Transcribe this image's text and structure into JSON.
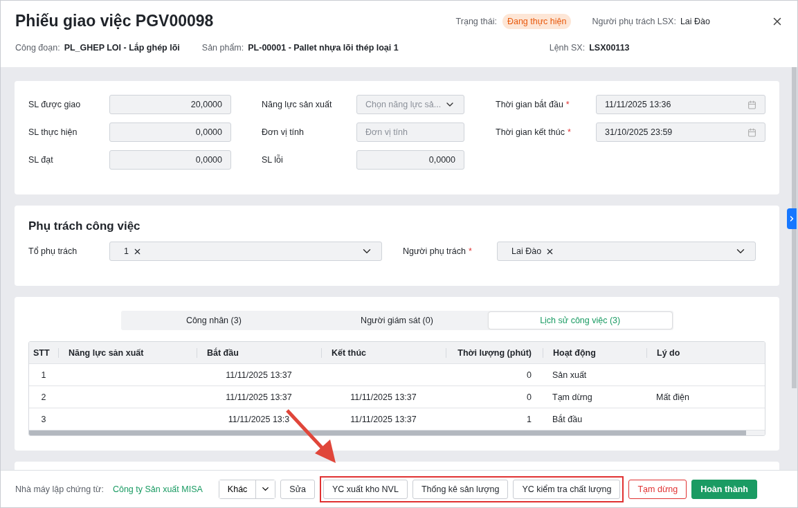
{
  "header": {
    "title": "Phiếu giao việc PGV00098",
    "status_label": "Trạng thái:",
    "status": "Đang thực hiện",
    "owner_label": "Người phụ trách LSX:",
    "owner": "Lai Đào",
    "meta": [
      {
        "label": "Công đoạn:",
        "value": "PL_GHEP LOI - Lắp ghép lõi"
      },
      {
        "label": "Sản phẩm:",
        "value": "PL-00001 - Pallet nhựa lõi thép loại 1"
      },
      {
        "label": "Lệnh SX:",
        "value": "LSX00113"
      }
    ]
  },
  "quantities": [
    {
      "label": "SL được giao",
      "kind": "number",
      "value": "20,0000"
    },
    {
      "label": "Năng lực sản xuất",
      "kind": "select",
      "placeholder": "Chọn năng lực sả..."
    },
    {
      "label": "Thời gian bắt đầu",
      "kind": "date",
      "value": "11/11/2025 13:36",
      "required_mark": "*"
    },
    {
      "label": "SL thực hiện",
      "kind": "number",
      "value": "0,0000"
    },
    {
      "label": "Đơn vị tính",
      "kind": "text",
      "placeholder": "Đơn vị tính"
    },
    {
      "label": "Thời gian kết thúc",
      "kind": "date",
      "value": "31/10/2025 23:59",
      "required_mark": "*"
    },
    {
      "label": "SL đạt",
      "kind": "number",
      "value": "0,0000"
    },
    {
      "label": "SL lỗi",
      "kind": "number",
      "value": "0,0000"
    }
  ],
  "assignment": {
    "title": "Phụ trách công việc",
    "fields": [
      {
        "label": "Tổ phụ trách",
        "tags": [
          "1"
        ]
      },
      {
        "label": "Người phụ trách",
        "required_mark": "*",
        "tags": [
          "Lai Đào"
        ]
      }
    ]
  },
  "tabs": [
    {
      "label": "Công nhân (3)",
      "selected": false
    },
    {
      "label": "Người giám sát (0)",
      "selected": false
    },
    {
      "label": "Lịch sử công việc (3)",
      "selected": true
    }
  ],
  "table": {
    "columns": [
      "STT",
      "Năng lực sản xuất",
      "Bắt đầu",
      "Kết thúc",
      "Thời lượng (phút)",
      "Hoạt động",
      "Lý do"
    ],
    "rows": [
      [
        "1",
        "",
        "11/11/2025 13:37",
        "",
        "0",
        "Sản xuất",
        ""
      ],
      [
        "2",
        "",
        "11/11/2025 13:37",
        "11/11/2025 13:37",
        "0",
        "Tạm dừng",
        "Mất điện"
      ],
      [
        "3",
        "",
        "11/11/2025 13:3",
        "11/11/2025 13:37",
        "1",
        "Bắt đầu",
        ""
      ]
    ]
  },
  "footer": {
    "factory_label": "Nhà máy lập chứng từ:",
    "factory_value": "Công ty Sản xuất MISA",
    "buttons": [
      {
        "label": "Khác",
        "kind": "split",
        "highlighted": false
      },
      {
        "label": "Sửa",
        "kind": "plain",
        "highlighted": false
      },
      {
        "label": "YC xuất kho NVL",
        "kind": "plain",
        "highlighted": true
      },
      {
        "label": "Thống kê sản lượng",
        "kind": "plain",
        "highlighted": true
      },
      {
        "label": "YC kiểm tra chất lượng",
        "kind": "plain",
        "highlighted": true
      },
      {
        "label": "Tạm dừng",
        "kind": "danger",
        "highlighted": false
      },
      {
        "label": "Hoàn thành",
        "kind": "primary",
        "highlighted": false
      }
    ]
  }
}
